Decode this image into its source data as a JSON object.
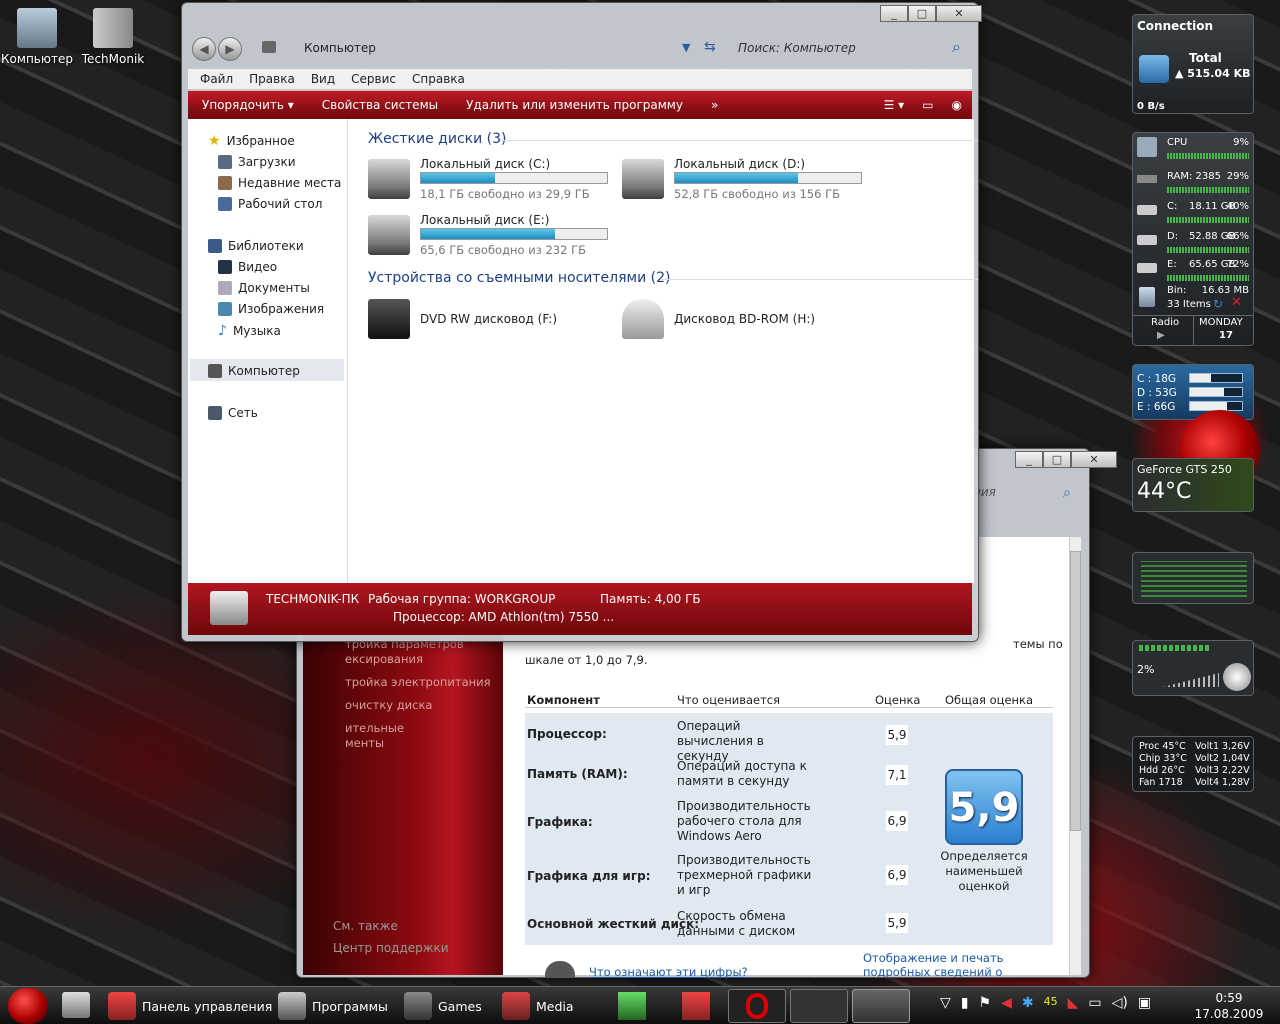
{
  "desktop": {
    "icons": [
      {
        "label": "Компьютер"
      },
      {
        "label": "TechMonik"
      }
    ]
  },
  "explorer": {
    "address": "Компьютер",
    "search_placeholder": "Поиск: Компьютер",
    "menu": [
      "Файл",
      "Правка",
      "Вид",
      "Сервис",
      "Справка"
    ],
    "toolbar": {
      "organize": "Упорядочить",
      "system_props": "Свойства системы",
      "uninstall": "Удалить или изменить программу",
      "more": "»"
    },
    "nav": {
      "favorites": "Избранное",
      "downloads": "Загрузки",
      "recent": "Недавние места",
      "desktop": "Рабочий стол",
      "libraries": "Библиотеки",
      "video": "Видео",
      "documents": "Документы",
      "pictures": "Изображения",
      "music": "Музыка",
      "computer": "Компьютер",
      "network": "Сеть"
    },
    "hdd_group": "Жесткие диски (3)",
    "drives": [
      {
        "name": "Локальный диск (C:)",
        "free": "18,1 ГБ свободно из 29,9 ГБ",
        "used_fraction": 0.4
      },
      {
        "name": "Локальный диск (D:)",
        "free": "52,8 ГБ свободно из 156 ГБ",
        "used_fraction": 0.66
      },
      {
        "name": "Локальный диск (E:)",
        "free": "65,6 ГБ свободно из 232 ГБ",
        "used_fraction": 0.72
      }
    ],
    "removable_group": "Устройства со съемными носителями (2)",
    "removable": [
      {
        "name": "DVD RW дисковод (F:)"
      },
      {
        "name": "Дисковод BD-ROM (H:)"
      }
    ],
    "status": {
      "pc": "TECHMONIK-ПК",
      "workgroup": "Рабочая группа: WORKGROUP",
      "memory": "Память: 4,00 ГБ",
      "cpu": "Процессор: AMD Athlon(tm) 7550 ..."
    }
  },
  "wei": {
    "search_tail": "ния",
    "desc": "темы по",
    "desc2": "шкале от 1,0 до 7,9.",
    "side_links": [
      "тройка параметров",
      "ексирования",
      "тройка электропитания",
      "очистку диска",
      "ительные",
      "менты"
    ],
    "see_also": "См. также",
    "see_also_link": "Центр поддержки",
    "headers": {
      "component": "Компонент",
      "what": "Что оценивается",
      "score": "Оценка",
      "total": "Общая оценка"
    },
    "rows": [
      {
        "component": "Процессор:",
        "what": "Операций вычисления в секунду",
        "score": "5,9"
      },
      {
        "component": "Память (RAM):",
        "what": "Операций доступа к памяти в секунду",
        "score": "7,1"
      },
      {
        "component": "Графика:",
        "what": "Производительность рабочего стола для Windows Aero",
        "score": "6,9"
      },
      {
        "component": "Графика для игр:",
        "what": "Производительность трехмерной графики и игр",
        "score": "6,9"
      },
      {
        "component": "Основной жесткий диск:",
        "what": "Скорость обмена данными с диском",
        "score": "5,9"
      }
    ],
    "base_score": "5,9",
    "base_caption": "Определяется наименьшей оценкой",
    "link1": "Что означают эти цифры?",
    "link2": "Отображение и печать подробных сведений о производительности"
  },
  "gadgets": {
    "connection": {
      "title": "Connection",
      "total_label": "Total",
      "total_value": "515.04 KB",
      "rate": "0 B/s"
    },
    "sysmon": {
      "cpu_label": "CPU",
      "cpu": "9%",
      "ram_label": "RAM: 2385",
      "ram": "29%",
      "disks": [
        {
          "label": "C:",
          "size": "18.11 GB",
          "pct": "40%"
        },
        {
          "label": "D:",
          "size": "52.88 GB",
          "pct": "66%"
        },
        {
          "label": "E:",
          "size": "65.65 GB",
          "pct": "72%"
        }
      ],
      "bin_label": "Bin:",
      "bin_size": "16.63 MB",
      "bin_items": "33 Items",
      "radio": "Radio",
      "day": "MONDAY",
      "date": "17"
    },
    "drives": [
      {
        "label": "C : 18G",
        "fill": 0.4
      },
      {
        "label": "D : 53G",
        "fill": 0.66
      },
      {
        "label": "E : 66G",
        "fill": 0.72
      }
    ],
    "gpu": {
      "name": "GeForce GTS 250",
      "temp": "44°C"
    },
    "volume": {
      "level": "2%"
    },
    "sensors": {
      "proc": "Proc",
      "proc_t": "45°C",
      "chip": "Chip",
      "chip_t": "33°C",
      "hdd": "Hdd",
      "hdd_t": "26°C",
      "fan": "Fan",
      "fan_v": "1718",
      "v1": "Volt1",
      "v1v": "3,26V",
      "v2": "Volt2",
      "v2v": "1,04V",
      "v3": "Volt3",
      "v3v": "2,22V",
      "v4": "Volt4",
      "v4v": "1,28V"
    }
  },
  "taskbar": {
    "items": [
      "Панель управления",
      "Программы",
      "Games",
      "Media"
    ],
    "tray_num": "45",
    "time": "0:59",
    "date": "17.08.2009"
  }
}
